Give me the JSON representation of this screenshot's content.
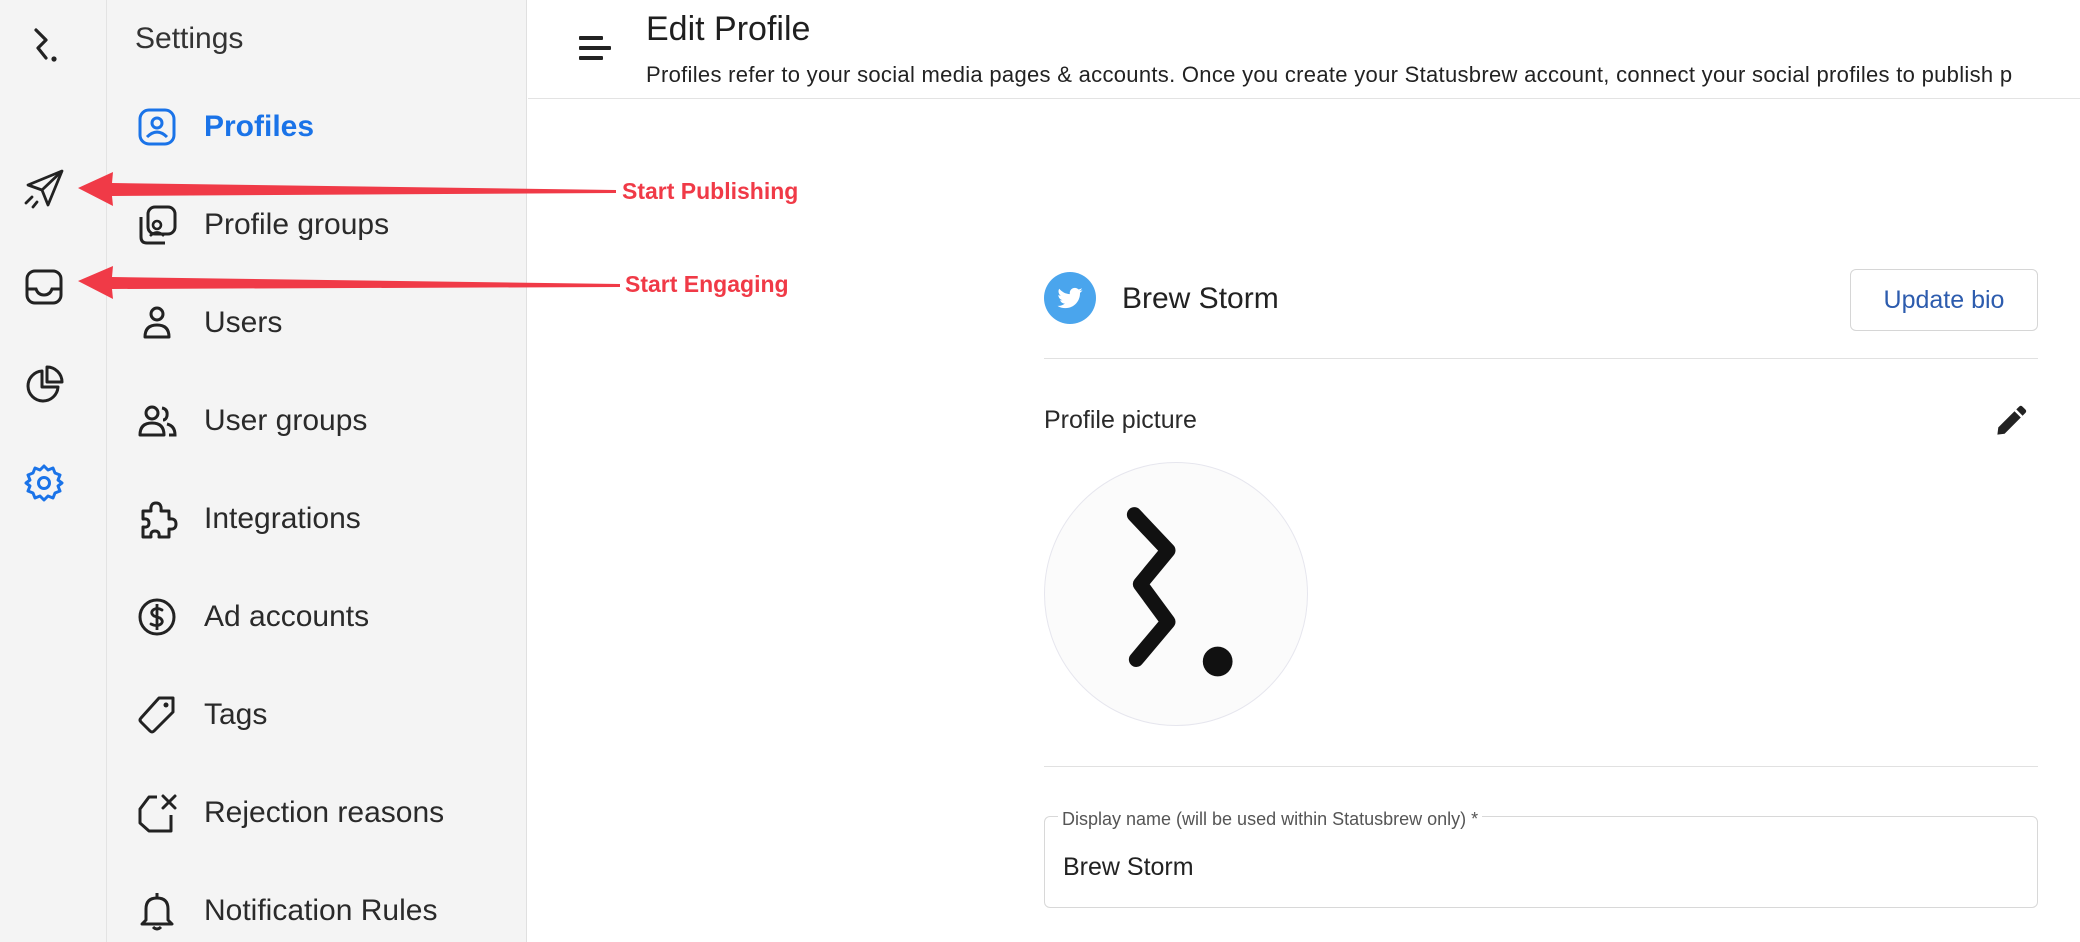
{
  "rail": {
    "items": [
      {
        "name": "statusbrew-logo"
      },
      {
        "name": "publish-icon"
      },
      {
        "name": "engage-inbox-icon"
      },
      {
        "name": "reports-icon"
      },
      {
        "name": "settings-icon"
      }
    ]
  },
  "sidebar": {
    "title": "Settings",
    "items": [
      {
        "label": "Profiles",
        "icon": "profile-icon",
        "active": true
      },
      {
        "label": "Profile groups",
        "icon": "profile-groups-icon"
      },
      {
        "label": "Users",
        "icon": "user-icon"
      },
      {
        "label": "User groups",
        "icon": "user-groups-icon"
      },
      {
        "label": "Integrations",
        "icon": "puzzle-icon"
      },
      {
        "label": "Ad accounts",
        "icon": "dollar-icon"
      },
      {
        "label": "Tags",
        "icon": "tag-icon"
      },
      {
        "label": "Rejection reasons",
        "icon": "rejection-icon"
      },
      {
        "label": "Notification Rules",
        "icon": "bell-icon"
      }
    ]
  },
  "header": {
    "title": "Edit Profile",
    "description": "Profiles refer to your social media pages & accounts. Once you create your Statusbrew account, connect your social profiles to publish p"
  },
  "profile": {
    "network": "twitter",
    "name": "Brew Storm",
    "update_bio_label": "Update bio",
    "picture_label": "Profile picture"
  },
  "display_name_field": {
    "label": "Display name (will be used within Statusbrew only) *",
    "value": "Brew Storm"
  },
  "annotations": [
    {
      "text": "Start Publishing"
    },
    {
      "text": "Start Engaging"
    }
  ],
  "colors": {
    "accent": "#1a73e8",
    "twitter": "#4aa5ed",
    "annotation": "#f03a47",
    "button_text": "#2d5cae"
  }
}
